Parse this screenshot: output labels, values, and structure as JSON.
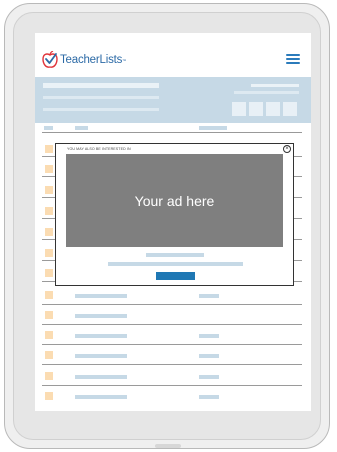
{
  "header": {
    "logo_text": "TeacherLists",
    "logo_tm": "™"
  },
  "modal": {
    "label": "YOU MAY ALSO BE INTERESTED IN",
    "ad_text": "Your ad here",
    "close_glyph": "×"
  },
  "colors": {
    "brand_blue": "#2c6aa6",
    "banner": "#c6d9e6",
    "row_accent": "#fbdcb2",
    "button": "#1f78b4",
    "ad_background": "#7f7f7f"
  },
  "icons": [
    "apple-check-icon",
    "hamburger-menu-icon",
    "close-icon"
  ]
}
